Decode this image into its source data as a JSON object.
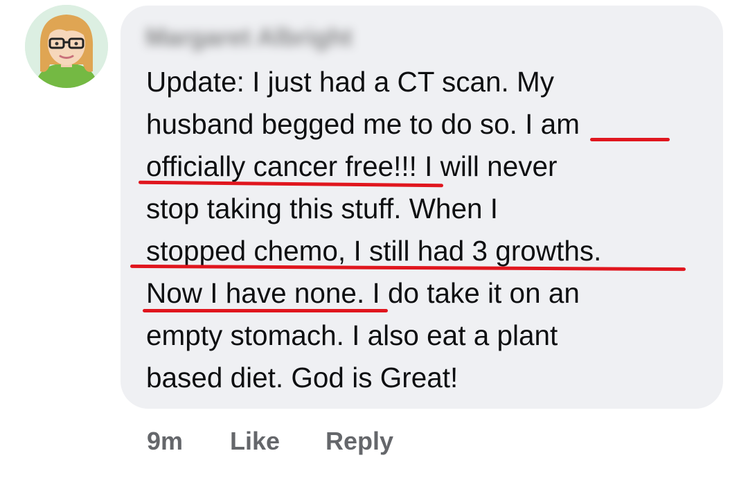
{
  "comment": {
    "author": "Margaret Albright",
    "lines": [
      "Update: I just had a CT scan. My",
      "husband begged me to do so. I am",
      "officially cancer free!!! I will never",
      "stop taking this stuff. When I",
      "stopped chemo, I still had 3 growths.",
      "Now I have none. I do take it on an",
      "empty stomach. I also eat a plant",
      "based diet. God is Great!"
    ],
    "actions": {
      "time": "9m",
      "like": "Like",
      "reply": "Reply"
    }
  },
  "colors": {
    "bubble": "#eff0f3",
    "text": "#0e0f11",
    "actions": "#65676b",
    "underline": "#e0161e"
  },
  "icons": {
    "avatar": "cartoon-woman-avatar-icon"
  }
}
